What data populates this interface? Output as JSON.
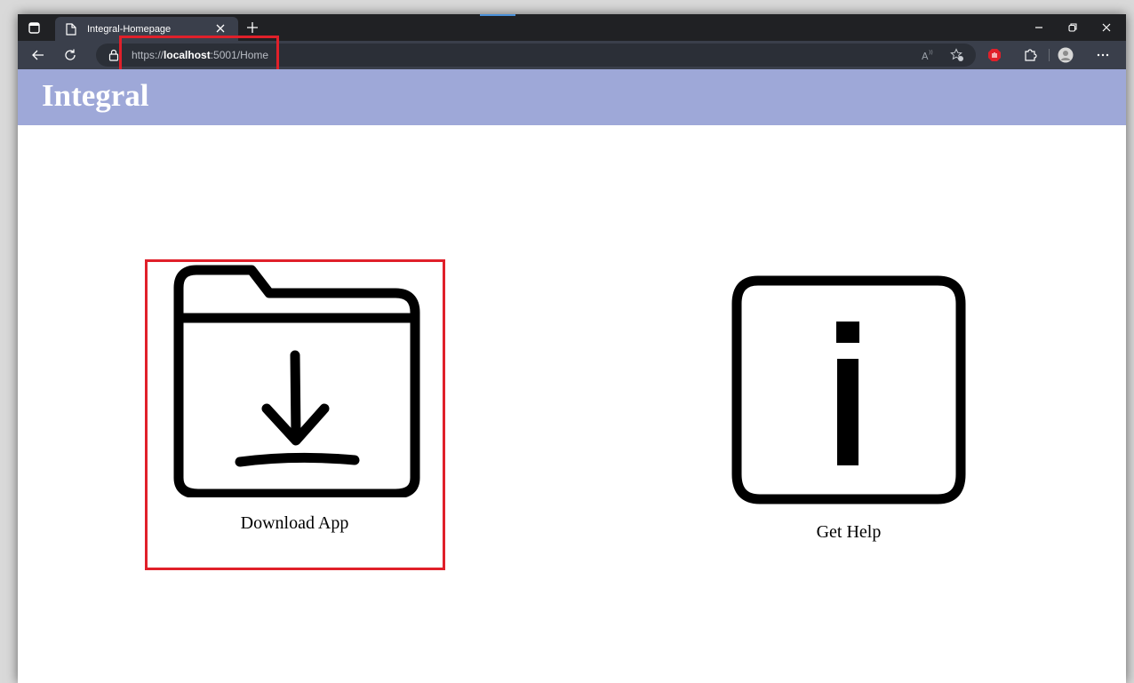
{
  "browser": {
    "tab": {
      "title": "Integral-Homepage",
      "favicon": "page-icon",
      "close_icon": "close-icon"
    },
    "new_tab_icon": "plus-icon",
    "window_controls": [
      "minimize-icon",
      "restore-icon",
      "close-icon"
    ],
    "nav": {
      "back_icon": "arrow-left-icon",
      "refresh_icon": "refresh-icon"
    },
    "address": {
      "lock_icon": "lock-icon",
      "url_prefix": "https://",
      "url_host": "localhost",
      "url_rest": ":5001/Home"
    },
    "toolbar_icons": [
      "read-aloud-icon",
      "add-favorite-icon",
      "adblock-icon",
      "extensions-icon",
      "profile-icon",
      "more-icon"
    ]
  },
  "page": {
    "brand": "Integral",
    "header_color": "#9ea8d8",
    "cards": [
      {
        "label": "Download App",
        "icon": "folder-download-icon"
      },
      {
        "label": "Get Help",
        "icon": "info-icon"
      }
    ]
  },
  "annotation_color": "#e0202a"
}
